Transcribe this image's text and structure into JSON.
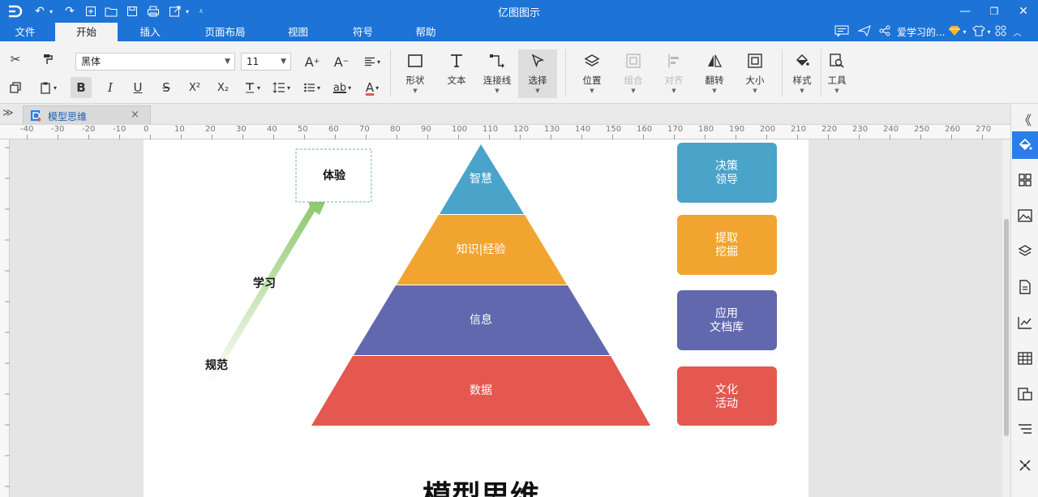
{
  "app": {
    "title": "亿图图示"
  },
  "menu": {
    "items": [
      "文件",
      "开始",
      "插入",
      "页面布局",
      "视图",
      "符号",
      "帮助"
    ],
    "active_index": 1,
    "user_name": "爱学习的..."
  },
  "ribbon": {
    "font_name": "黑体",
    "font_size": "11",
    "bold_label": "B",
    "italic_label": "I",
    "underline_label": "U",
    "strike_label": "S",
    "sup_label": "X²",
    "sub_label": "X₂",
    "shape_label": "形状",
    "text_label": "文本",
    "connector_label": "连接线",
    "select_label": "选择",
    "position_label": "位置",
    "group_label": "组合",
    "align_label": "对齐",
    "flip_label": "翻转",
    "size_label": "大小",
    "style_label": "样式",
    "tools_label": "工具"
  },
  "tabs": [
    {
      "label": "模型思维"
    }
  ],
  "ruler": {
    "ticks": [
      "-40",
      "-30",
      "-20",
      "-10",
      "0",
      "10",
      "20",
      "30",
      "40",
      "50",
      "60",
      "70",
      "80",
      "90",
      "100",
      "110",
      "120",
      "130",
      "140",
      "150",
      "160",
      "170",
      "180",
      "190",
      "200",
      "210",
      "220",
      "230",
      "240",
      "250",
      "260",
      "270"
    ]
  },
  "diagram": {
    "pyramid": [
      {
        "label": "智慧",
        "color": "#4aa3c9"
      },
      {
        "label": "知识|经验",
        "color": "#f2a431"
      },
      {
        "label": "信息",
        "color": "#6168ad"
      },
      {
        "label": "数据",
        "color": "#e4584f"
      }
    ],
    "side_boxes": [
      {
        "line1": "决策",
        "line2": "领导",
        "color": "#4aa3c9"
      },
      {
        "line1": "提取",
        "line2": "挖掘",
        "color": "#f2a431"
      },
      {
        "line1": "应用",
        "line2": "文档库",
        "color": "#6168ad"
      },
      {
        "line1": "文化",
        "line2": "活动",
        "color": "#e4584f"
      }
    ],
    "experience_label": "体验",
    "learn_label": "学习",
    "norm_label": "规范",
    "page_title": "模型思维",
    "arrow_color": "#8cc76a"
  },
  "colors": {
    "accent": "#1d73d6",
    "panel_active": "#2b7de9"
  }
}
